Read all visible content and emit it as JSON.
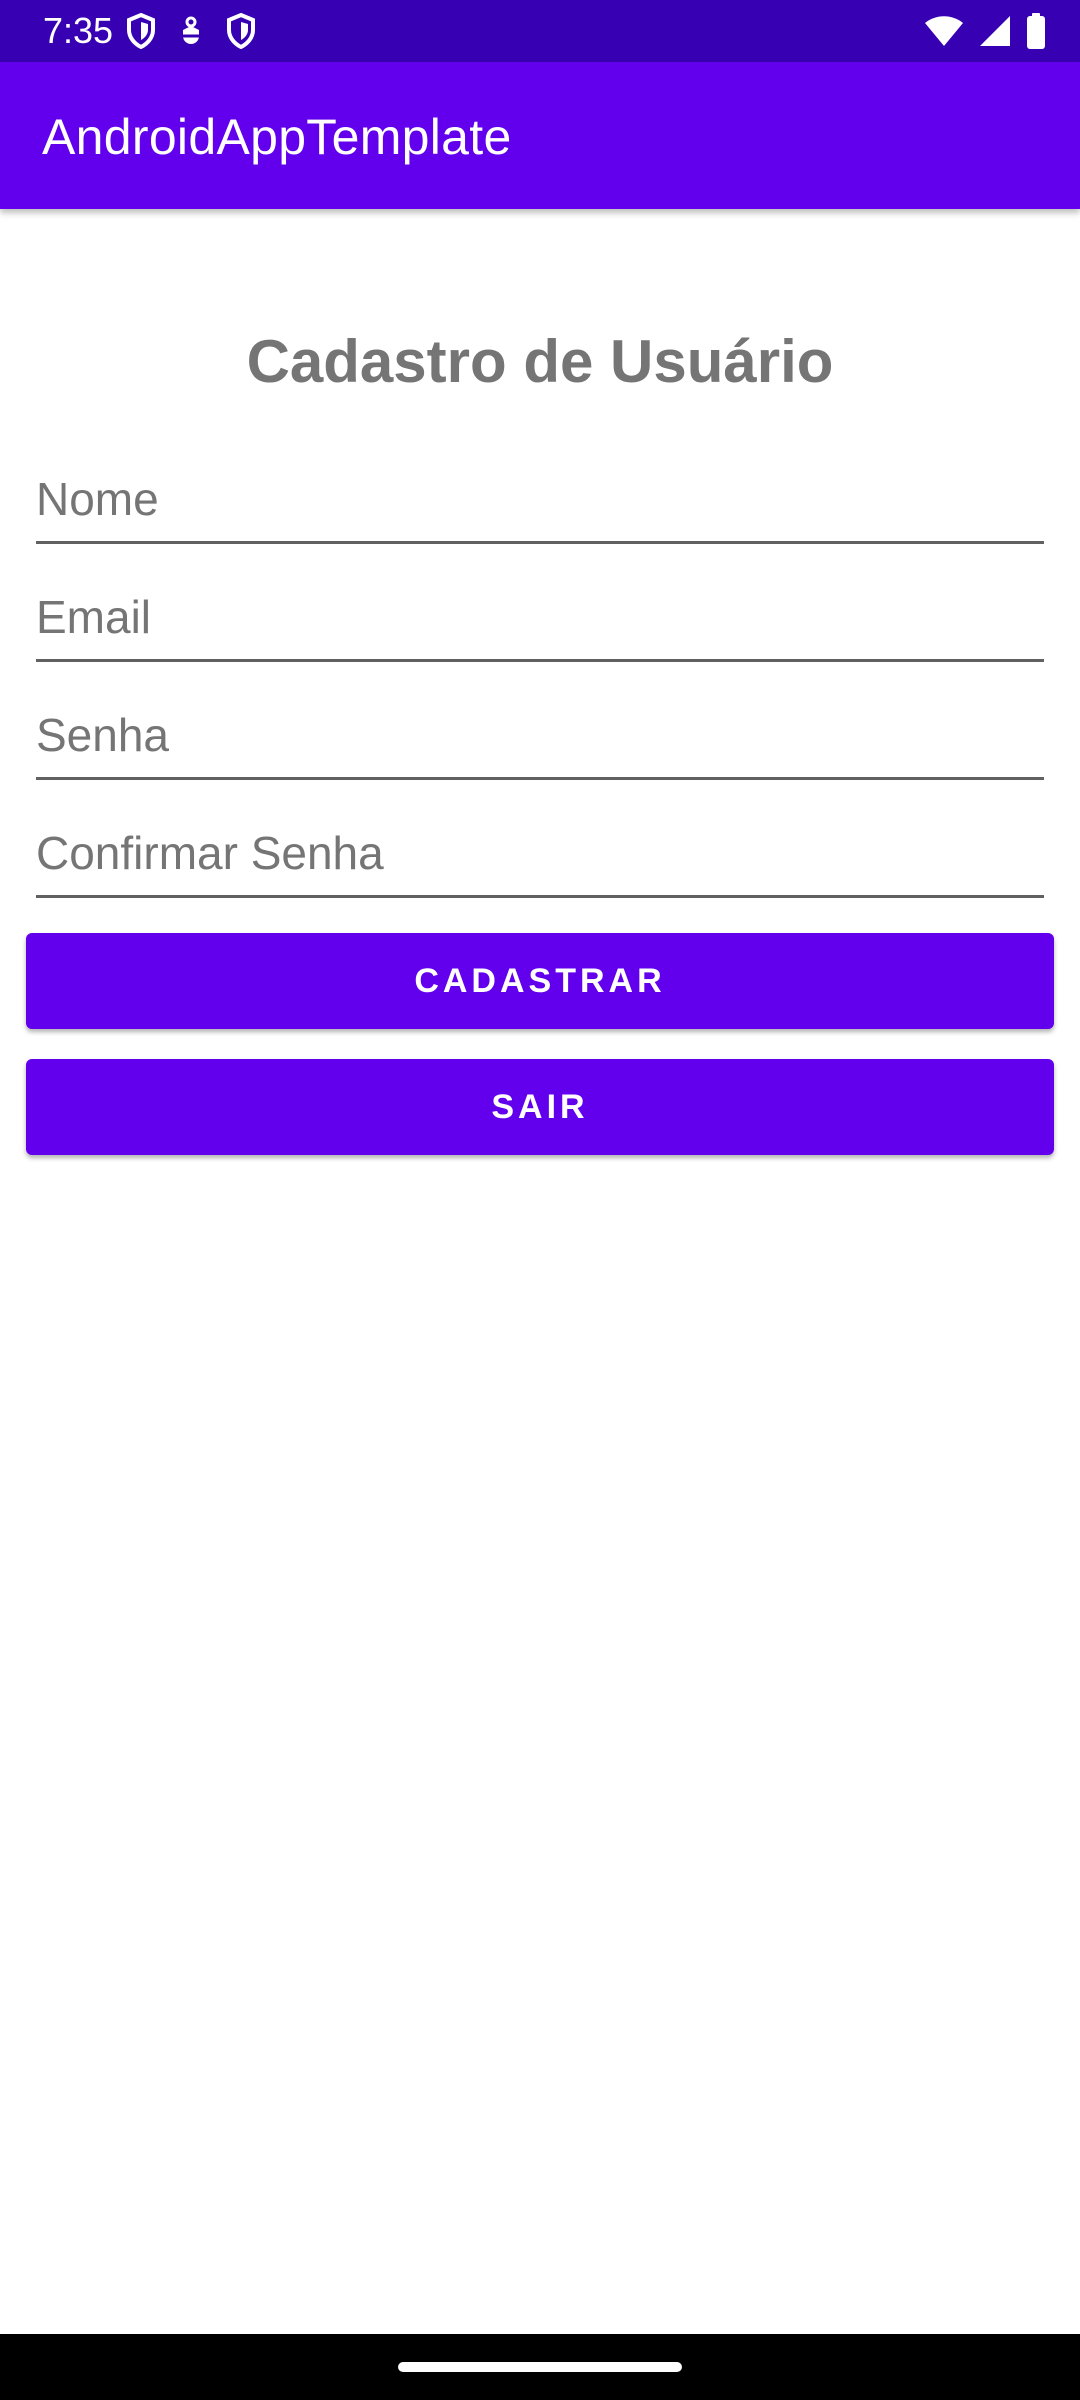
{
  "status_bar": {
    "time": "7:35",
    "left_icons": [
      "shield-icon",
      "usb-debug-icon",
      "shield-icon"
    ],
    "right_icons": [
      "wifi-icon",
      "cellular-signal-icon",
      "battery-icon"
    ],
    "background": "#3700b3"
  },
  "app_bar": {
    "title": "AndroidAppTemplate",
    "background": "#6200ee"
  },
  "form": {
    "title": "Cadastro de Usuário",
    "fields": {
      "nome": {
        "placeholder": "Nome",
        "value": ""
      },
      "email": {
        "placeholder": "Email",
        "value": ""
      },
      "senha": {
        "placeholder": "Senha",
        "value": ""
      },
      "confirmar_senha": {
        "placeholder": "Confirmar Senha",
        "value": ""
      }
    },
    "buttons": {
      "cadastrar": "CADASTRAR",
      "sair": "SAIR"
    },
    "accent": "#6200ee"
  },
  "nav_bar": {
    "background": "#000000"
  }
}
